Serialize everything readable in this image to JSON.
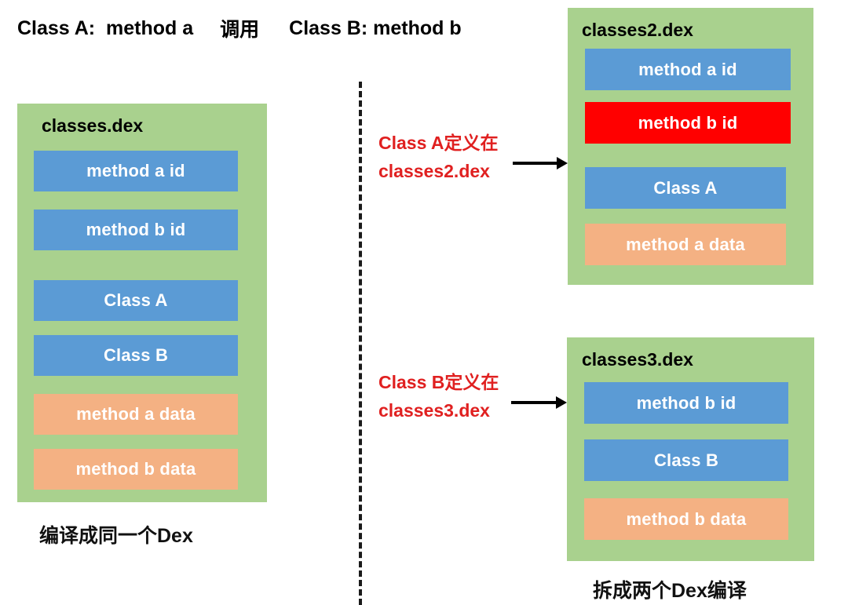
{
  "header": {
    "left_class": "Class A:  method a",
    "call_word": "调用",
    "right_class": "Class B: method b"
  },
  "left_panel": {
    "title": "classes.dex",
    "caption": "编译成同一个Dex",
    "slots": [
      {
        "label": "method a id",
        "color": "blue"
      },
      {
        "label": "method b id",
        "color": "blue"
      },
      {
        "label": "Class A",
        "color": "blue"
      },
      {
        "label": "Class B",
        "color": "blue"
      },
      {
        "label": "method a data",
        "color": "orange"
      },
      {
        "label": "method b data",
        "color": "orange"
      }
    ]
  },
  "right_top_panel": {
    "title": "classes2.dex",
    "slots": [
      {
        "label": "method a id",
        "color": "blue"
      },
      {
        "label": "method b id",
        "color": "red"
      },
      {
        "label": "Class A",
        "color": "blue"
      },
      {
        "label": "method a data",
        "color": "orange"
      }
    ]
  },
  "right_bottom_panel": {
    "title": "classes3.dex",
    "caption": "拆成两个Dex编译",
    "slots": [
      {
        "label": "method b id",
        "color": "blue"
      },
      {
        "label": "Class B",
        "color": "blue"
      },
      {
        "label": "method b data",
        "color": "orange"
      }
    ]
  },
  "annotations": {
    "top": {
      "line1": "Class A定义在",
      "line2": "classes2.dex"
    },
    "bottom": {
      "line1": "Class B定义在",
      "line2": "classes3.dex"
    }
  },
  "colors": {
    "green_panel": "#A9D18E",
    "blue_slot": "#5B9BD5",
    "red_slot": "#FF0000",
    "orange_slot": "#F4B183",
    "annotation_red": "#E02020",
    "text_black": "#000000",
    "arrow_black": "#000000"
  }
}
